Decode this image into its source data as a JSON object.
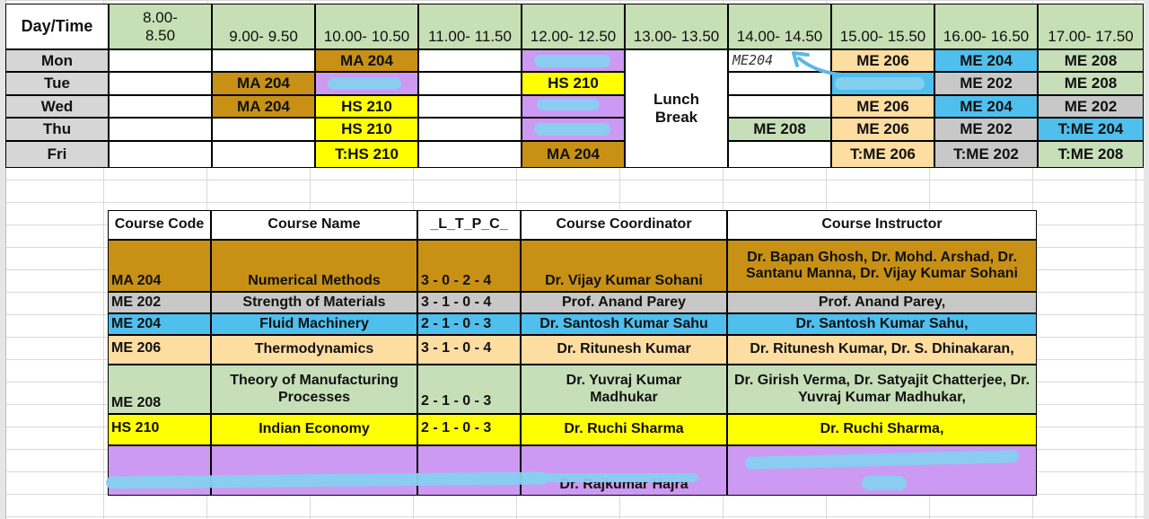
{
  "timetable": {
    "corner": "Day/Time",
    "times": [
      "8.00-\n8.50",
      "9.00- 9.50",
      "10.00- 10.50",
      "11.00- 11.50",
      "12.00- 12.50",
      "13.00- 13.50",
      "14.00- 14.50",
      "15.00- 15.50",
      "16.00- 16.50",
      "17.00- 17.50"
    ],
    "days": [
      "Mon",
      "Tue",
      "Wed",
      "Thu",
      "Fri"
    ],
    "lunch": "Lunch\nBreak",
    "cells": {
      "mon_1000": "MA 204",
      "mon_1400": "ME204",
      "mon_1500": "ME 206",
      "mon_1600": "ME 204",
      "mon_1700": "ME 208",
      "tue_0900": "MA 204",
      "tue_1200": "HS 210",
      "tue_1600": "ME 202",
      "tue_1700": "ME 208",
      "wed_0900": "MA 204",
      "wed_1000": "HS 210",
      "wed_1500": "ME 206",
      "wed_1600": "ME 204",
      "wed_1700": "ME 202",
      "thu_1000": "HS 210",
      "thu_1400": "ME 208",
      "thu_1500": "ME 206",
      "thu_1600": "ME 202",
      "thu_1700": "T:ME 204",
      "fri_1000": "T:HS 210",
      "fri_1200": "MA 204",
      "fri_1500": "T:ME 206",
      "fri_1600": "T:ME 202",
      "fri_1700": "T:ME 208"
    }
  },
  "courses": {
    "headers": [
      "Course Code",
      "Course Name",
      "_L_T_P_C_",
      "Course Coordinator",
      "Course Instructor"
    ],
    "rows": [
      {
        "code": "MA 204",
        "name": "Numerical Methods",
        "ltpc": "3 - 0 - 2 - 4",
        "coordinator": "Dr. Vijay Kumar Sohani",
        "instructor": "Dr. Bapan Ghosh, Dr. Mohd. Arshad, Dr. Santanu Manna, Dr. Vijay Kumar Sohani"
      },
      {
        "code": "ME 202",
        "name": "Strength of Materials",
        "ltpc": "3 - 1 - 0 - 4",
        "coordinator": "Prof. Anand Parey",
        "instructor": "Prof. Anand Parey,"
      },
      {
        "code": "ME 204",
        "name": "Fluid Machinery",
        "ltpc": "2 - 1 - 0 - 3",
        "coordinator": "Dr. Santosh Kumar Sahu",
        "instructor": "Dr. Santosh Kumar Sahu,"
      },
      {
        "code": "ME 206",
        "name": "Thermodynamics",
        "ltpc": "3 - 1 - 0 - 4",
        "coordinator": "Dr. Ritunesh Kumar",
        "instructor": "Dr. Ritunesh Kumar, Dr. S. Dhinakaran,"
      },
      {
        "code": "ME 208",
        "name": "Theory of Manufacturing Processes",
        "ltpc": "2 - 1 - 0 - 3",
        "coordinator": "Dr. Yuvraj Kumar Madhukar",
        "instructor": "Dr. Girish Verma, Dr. Satyajit Chatterjee, Dr. Yuvraj Kumar Madhukar,"
      },
      {
        "code": "HS 210",
        "name": "Indian Economy",
        "ltpc": "2 - 1 - 0 - 3",
        "coordinator": "Dr. Ruchi Sharma",
        "instructor": "Dr. Ruchi Sharma,"
      },
      {
        "code": "",
        "name": "",
        "ltpc": "",
        "coordinator": "Dr. Rajkumar Hajra",
        "instructor": ""
      }
    ]
  },
  "colors": {
    "MA 204": "#c89116",
    "ME 202": "#c8c8c8",
    "ME 204": "#4fbfee",
    "ME 206": "#fedda0",
    "ME 208": "#c7dfb8",
    "HS 210": "#ffff00",
    "redacted": "#cc9af2"
  }
}
